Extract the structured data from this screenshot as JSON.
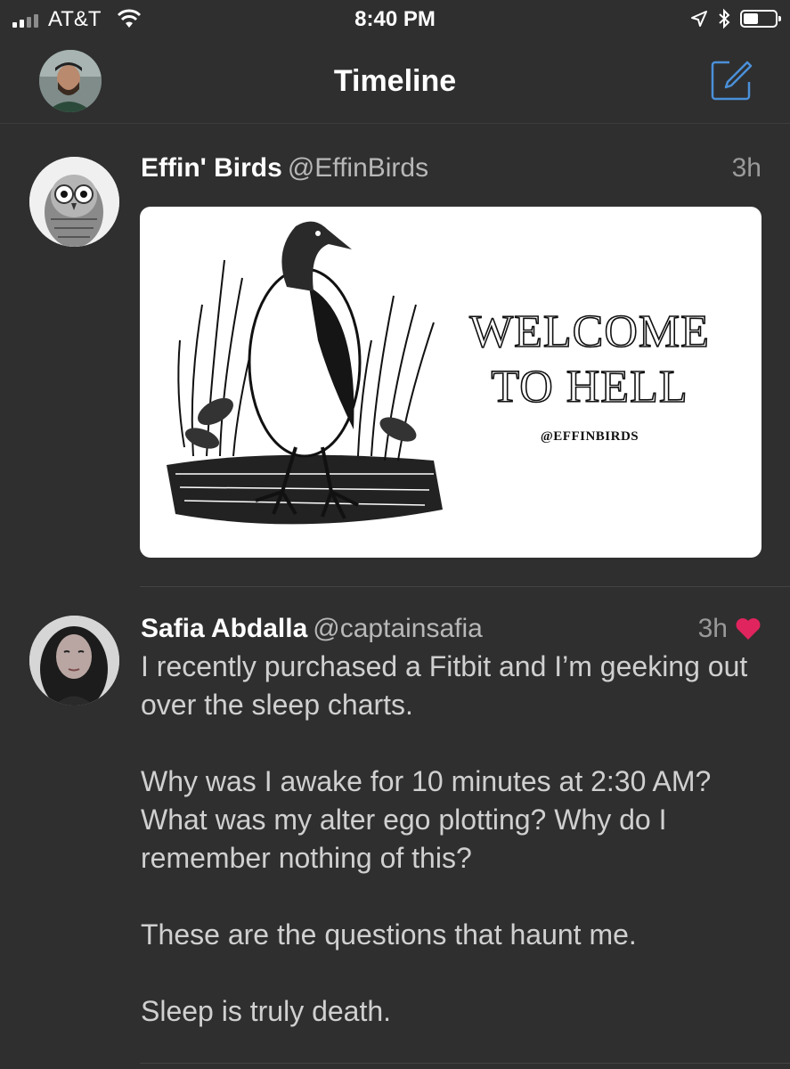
{
  "status_bar": {
    "carrier": "AT&T",
    "time": "8:40 PM"
  },
  "nav": {
    "title": "Timeline"
  },
  "tweets": [
    {
      "name": "Effin' Birds",
      "handle": "@EffinBirds",
      "time": "3h",
      "media": {
        "title_line1": "WELCOME",
        "title_line2": "TO HELL",
        "credit": "@EFFINBIRDS"
      }
    },
    {
      "name": "Safia Abdalla",
      "handle": "@captainsafia",
      "time": "3h",
      "liked": true,
      "paragraphs": [
        "I recently purchased a Fitbit and I’m geeking out over the sleep charts.",
        "Why was I awake for 10 minutes at 2:30 AM? What was my alter ego plotting? Why do I remember nothing of this?",
        "These are the questions that haunt me.",
        "Sleep is truly death."
      ]
    }
  ],
  "colors": {
    "background": "#2f2f2f",
    "accent_blue": "#4a90d9",
    "like_red": "#e0245e"
  },
  "icons": {
    "signal": "signal-bars-icon",
    "wifi": "wifi-icon",
    "location": "location-arrow-icon",
    "bluetooth": "bluetooth-icon",
    "battery": "battery-icon",
    "compose": "compose-icon",
    "like": "heart-icon"
  }
}
